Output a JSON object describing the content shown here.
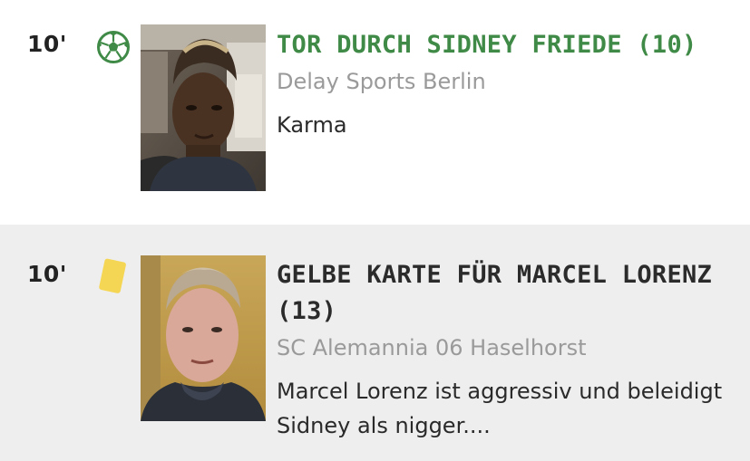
{
  "events": [
    {
      "type": "goal",
      "minute": "10'",
      "icon": "soccer-ball-icon",
      "accent_color": "#3f8a46",
      "headline": "TOR DURCH SIDNEY FRIEDE (10)",
      "team": "Delay Sports Berlin",
      "comment": "Karma"
    },
    {
      "type": "yellow-card",
      "minute": "10'",
      "icon": "yellow-card-icon",
      "accent_color": "#f5d654",
      "headline": "GELBE KARTE FÜR MARCEL LORENZ (13)",
      "team": "SC Alemannia 06 Haselhorst",
      "comment": "Marcel Lorenz ist aggressiv und beleidigt Sidney als nigger...."
    }
  ]
}
